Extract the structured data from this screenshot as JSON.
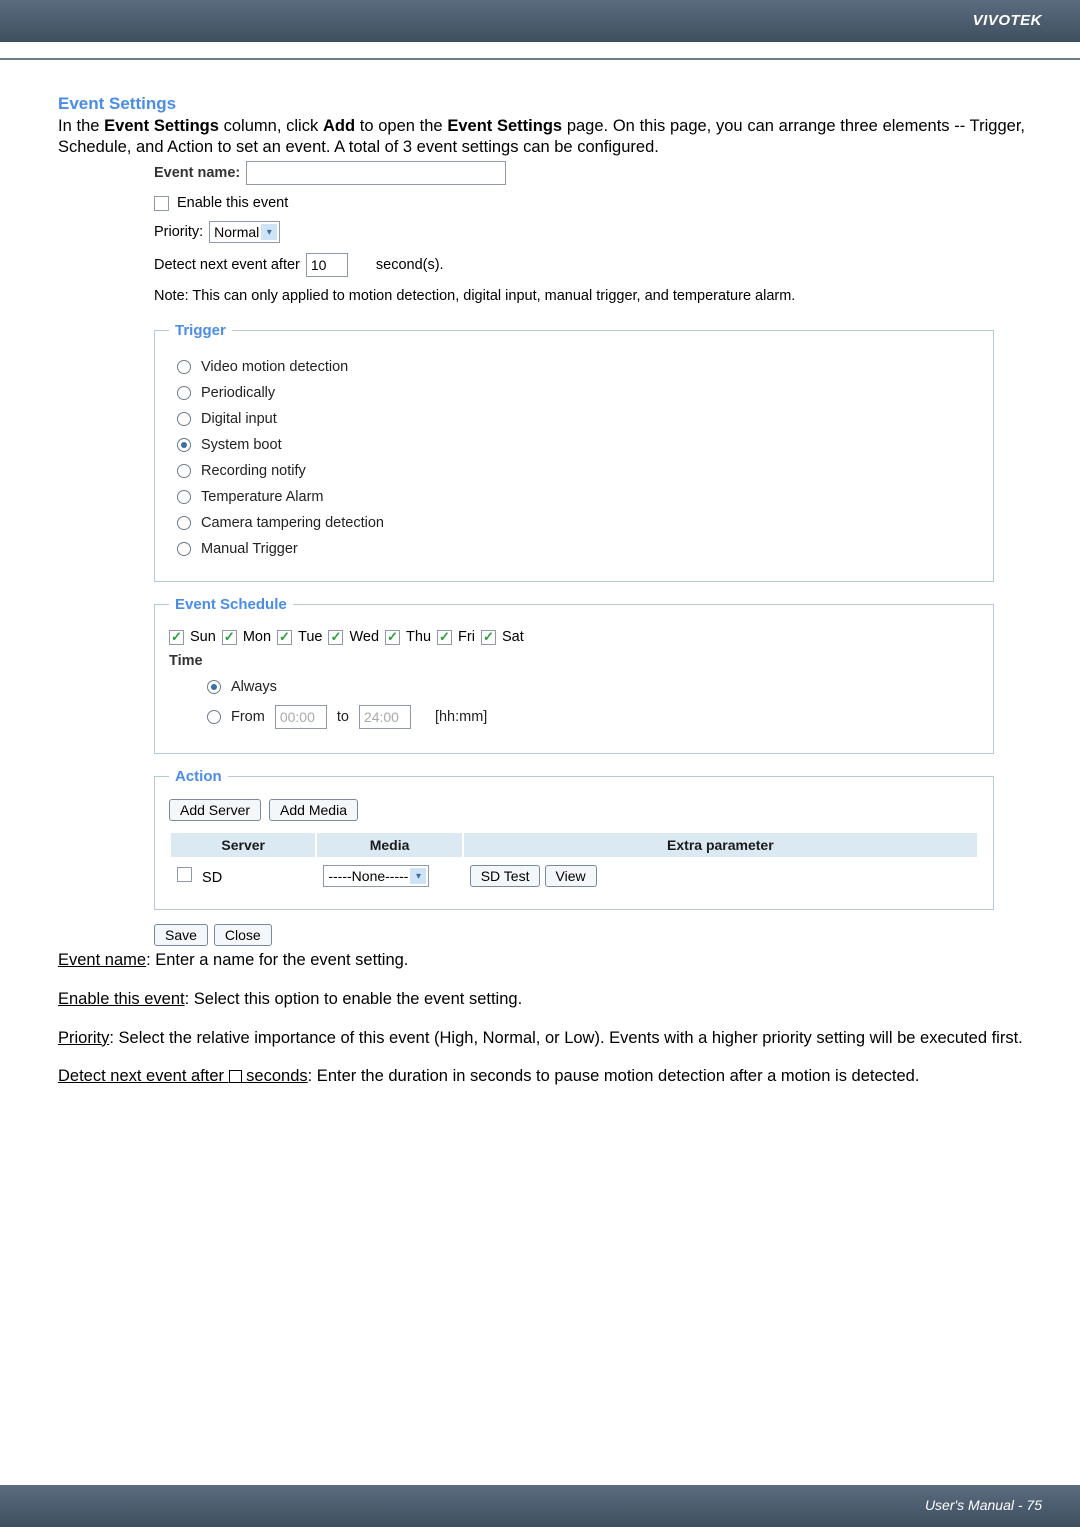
{
  "brand": "VIVOTEK",
  "section_title": "Event Settings",
  "intro_parts": {
    "p1": "In the ",
    "b1": "Event Settings",
    "p2": " column, click ",
    "b2": "Add",
    "p3": " to open the ",
    "b3": "Event Settings",
    "p4": " page. On this page, you can arrange three elements -- Trigger, Schedule, and Action to set an event. A total of 3 event settings can be configured."
  },
  "form": {
    "event_name_label": "Event name:",
    "event_name_value": "",
    "enable_label": "Enable this event",
    "priority_label": "Priority:",
    "priority_value": "Normal",
    "detect_label_pre": "Detect next event after",
    "detect_value": "10",
    "detect_label_post": "second(s).",
    "note": "Note: This can only applied to motion detection, digital input, manual trigger, and temperature alarm."
  },
  "trigger": {
    "legend": "Trigger",
    "options": [
      {
        "label": "Video motion detection",
        "checked": false
      },
      {
        "label": "Periodically",
        "checked": false
      },
      {
        "label": "Digital input",
        "checked": false
      },
      {
        "label": "System boot",
        "checked": true
      },
      {
        "label": "Recording notify",
        "checked": false
      },
      {
        "label": "Temperature Alarm",
        "checked": false
      },
      {
        "label": "Camera tampering detection",
        "checked": false
      },
      {
        "label": "Manual Trigger",
        "checked": false
      }
    ]
  },
  "schedule": {
    "legend": "Event Schedule",
    "days": [
      "Sun",
      "Mon",
      "Tue",
      "Wed",
      "Thu",
      "Fri",
      "Sat"
    ],
    "time_label": "Time",
    "always_label": "Always",
    "from_label": "From",
    "from_value": "00:00",
    "to_label": "to",
    "to_value": "24:00",
    "hhmm": "[hh:mm]"
  },
  "action": {
    "legend": "Action",
    "add_server": "Add Server",
    "add_media": "Add Media",
    "th_server": "Server",
    "th_media": "Media",
    "th_extra": "Extra parameter",
    "row_sd": "SD",
    "media_sel": "-----None-----",
    "sd_test": "SD Test",
    "view": "View"
  },
  "save": "Save",
  "close": "Close",
  "defs": {
    "d1_u": "Event name",
    "d1_t": ": Enter a name for the event setting.",
    "d2_u": "Enable this event",
    "d2_t": ": Select this option to enable the event setting.",
    "d3_u": "Priority",
    "d3_t": ": Select the relative importance of this event (High, Normal, or Low). Events with a higher priority setting will be executed first.",
    "d4_u1": "Detect next event after ",
    "d4_u2": " seconds",
    "d4_t": ": Enter the duration in seconds to pause motion detection after a motion is detected."
  },
  "footer": "User's Manual - 75"
}
